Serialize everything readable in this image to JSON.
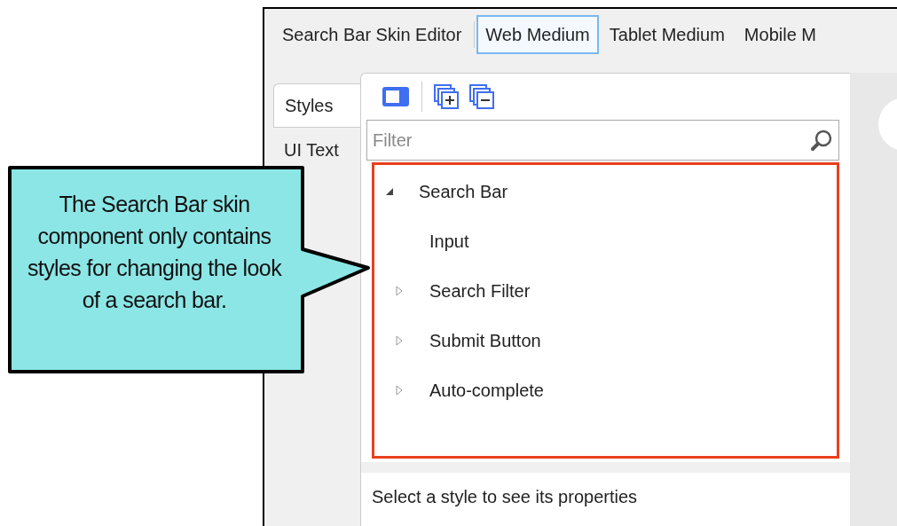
{
  "editor_tabs": [
    {
      "label": "Search Bar Skin Editor",
      "selected": false
    },
    {
      "label": "Web Medium",
      "selected": true
    },
    {
      "label": "Tablet Medium",
      "selected": false
    },
    {
      "label": "Mobile M",
      "selected": false
    }
  ],
  "side_tabs": [
    {
      "label": "Styles",
      "selected": true
    },
    {
      "label": "UI Text",
      "selected": false
    }
  ],
  "filter": {
    "placeholder": "Filter"
  },
  "tree": [
    {
      "kind": "node",
      "label": "Search Bar",
      "expanded": true,
      "children": [
        {
          "kind": "leaf",
          "label": "Input"
        },
        {
          "kind": "node",
          "label": "Search Filter",
          "expanded": false
        },
        {
          "kind": "node",
          "label": "Submit Button",
          "expanded": false
        },
        {
          "kind": "node",
          "label": "Auto-complete",
          "expanded": false
        }
      ]
    }
  ],
  "status": "Select a style to see its properties",
  "callout": {
    "text": "The Search Bar skin component only contains styles for changing the look of a search bar."
  }
}
